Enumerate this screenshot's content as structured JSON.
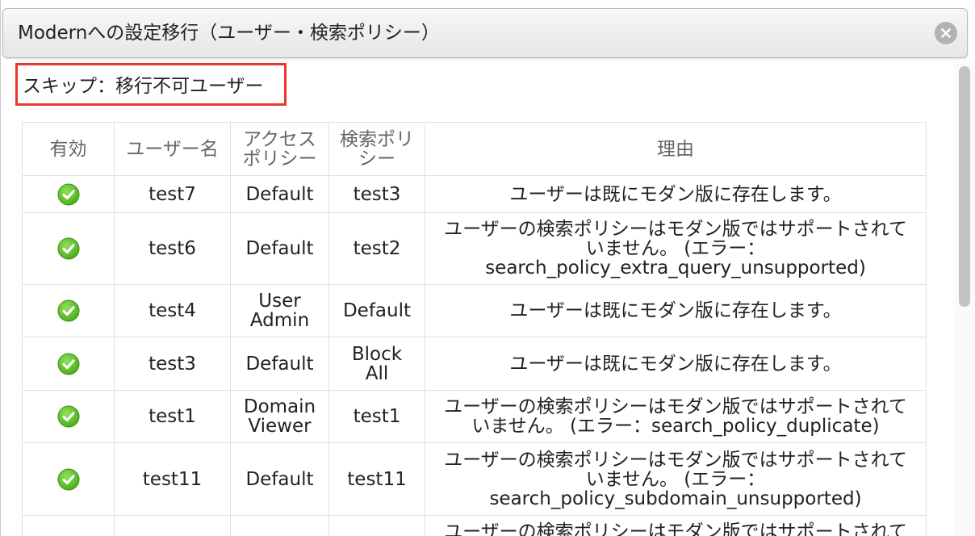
{
  "dialog": {
    "title": "Modernへの設定移行（ユーザー・検索ポリシー）",
    "close_icon": "close-circle-icon",
    "section_label": "スキップ：移行不可ユーザー"
  },
  "table": {
    "headers": {
      "enabled": "有効",
      "username": "ユーザー名",
      "access_policy_line1": "アクセス",
      "access_policy_line2": "ポリシー",
      "search_policy_line1": "検索ポリ",
      "search_policy_line2": "シー",
      "reason": "理由"
    },
    "rows": [
      {
        "enabled_icon": "check-circle-icon",
        "username": "test7",
        "access_policy": [
          "Default"
        ],
        "search_policy": [
          "test3"
        ],
        "reason": [
          "ユーザーは既にモダン版に存在します。"
        ]
      },
      {
        "enabled_icon": "check-circle-icon",
        "username": "test6",
        "access_policy": [
          "Default"
        ],
        "search_policy": [
          "test2"
        ],
        "reason": [
          "ユーザーの検索ポリシーはモダン版ではサポートされて",
          "いません。 (エラー：",
          "search_policy_extra_query_unsupported)"
        ]
      },
      {
        "enabled_icon": "check-circle-icon",
        "username": "test4",
        "access_policy": [
          "User",
          "Admin"
        ],
        "search_policy": [
          "Default"
        ],
        "reason": [
          "ユーザーは既にモダン版に存在します。"
        ]
      },
      {
        "enabled_icon": "check-circle-icon",
        "username": "test3",
        "access_policy": [
          "Default"
        ],
        "search_policy": [
          "Block",
          "All"
        ],
        "reason": [
          "ユーザーは既にモダン版に存在します。"
        ]
      },
      {
        "enabled_icon": "check-circle-icon",
        "username": "test1",
        "access_policy": [
          "Domain",
          "Viewer"
        ],
        "search_policy": [
          "test1"
        ],
        "reason": [
          "ユーザーの検索ポリシーはモダン版ではサポートされて",
          "いません。 (エラー：search_policy_duplicate)"
        ]
      },
      {
        "enabled_icon": "check-circle-icon",
        "username": "test11",
        "access_policy": [
          "Default"
        ],
        "search_policy": [
          "test11"
        ],
        "reason": [
          "ユーザーの検索ポリシーはモダン版ではサポートされて",
          "いません。 (エラー：",
          "search_policy_subdomain_unsupported)"
        ]
      },
      {
        "enabled_icon": "check-circle-icon",
        "username": "",
        "access_policy": [
          ""
        ],
        "search_policy": [
          ""
        ],
        "reason": [
          "ユーザーの検索ポリシーはモダン版ではサポートされて"
        ]
      }
    ]
  },
  "colors": {
    "highlight_border": "#e8392c",
    "check_green": "#4caf1c"
  }
}
